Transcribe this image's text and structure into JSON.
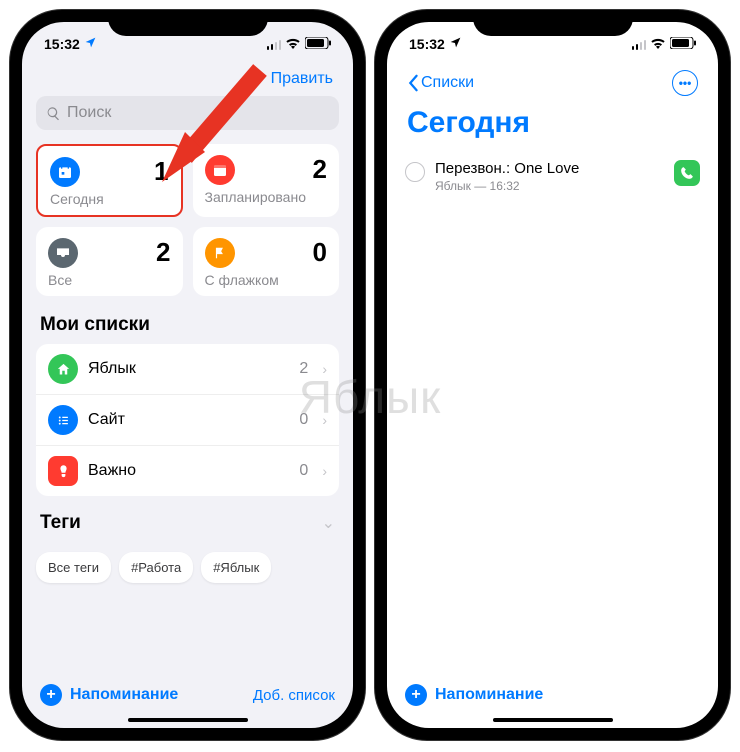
{
  "status": {
    "time": "15:32"
  },
  "left": {
    "edit": "Править",
    "search_placeholder": "Поиск",
    "cards": {
      "today": {
        "count": "1",
        "label": "Сегодня",
        "color": "#007aff"
      },
      "scheduled": {
        "count": "2",
        "label": "Запланировано",
        "color": "#ff3b30"
      },
      "all": {
        "count": "2",
        "label": "Все",
        "color": "#5b6770"
      },
      "flagged": {
        "count": "0",
        "label": "С флажком",
        "color": "#ff9500"
      }
    },
    "my_lists_title": "Мои списки",
    "lists": [
      {
        "label": "Яблык",
        "count": "2",
        "color": "#33c658",
        "icon": "home"
      },
      {
        "label": "Сайт",
        "count": "0",
        "color": "#007aff",
        "icon": "list"
      },
      {
        "label": "Важно",
        "count": "0",
        "color": "#ff3b30",
        "icon": "important"
      }
    ],
    "tags_title": "Теги",
    "tags": [
      "Все теги",
      "#Работа",
      "#Яблык"
    ],
    "add_reminder": "Напоминание",
    "add_list": "Доб. список"
  },
  "right": {
    "back": "Списки",
    "title": "Сегодня",
    "reminder": {
      "title": "Перезвон.: One Love",
      "sub": "Яблык — 16:32"
    },
    "add_reminder": "Напоминание"
  },
  "watermark": "Яблык"
}
